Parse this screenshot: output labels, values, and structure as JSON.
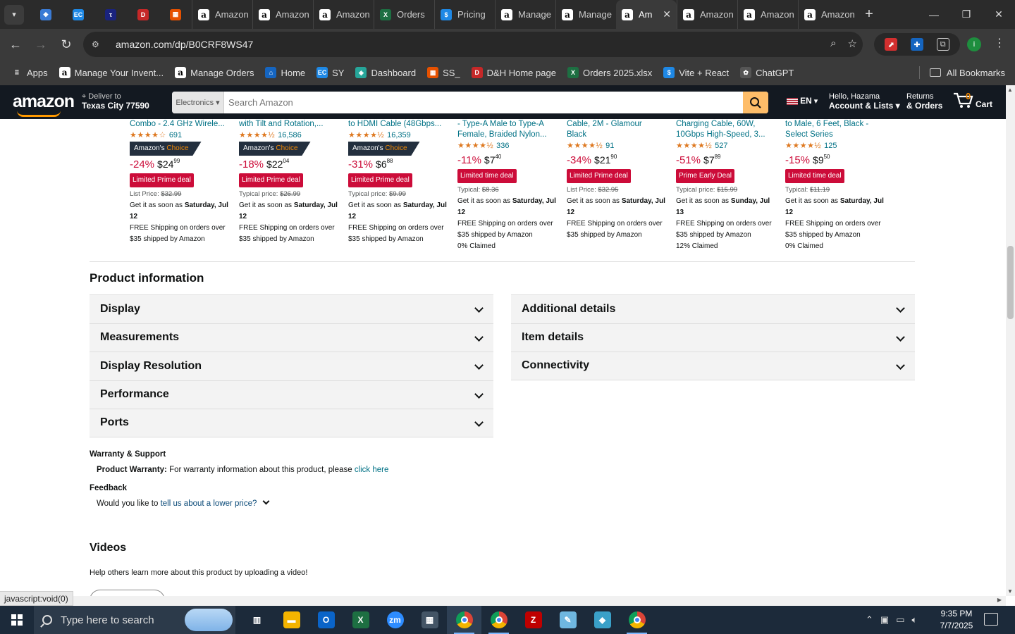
{
  "browser": {
    "pinned_tabs": [
      {
        "icon": "dell-icon",
        "color": "#3a7bd5"
      },
      {
        "icon": "ec-icon",
        "color": "#1e88e5",
        "text": "EC"
      },
      {
        "icon": "tau-icon",
        "color": "#1a237e",
        "text": "tau"
      },
      {
        "icon": "dh-icon",
        "color": "#c62828",
        "text": "D&H"
      },
      {
        "icon": "package-icon",
        "color": "#e65100"
      }
    ],
    "tabs": [
      {
        "label": "Amazon",
        "icon": "amazon-icon"
      },
      {
        "label": "Amazon",
        "icon": "amazon-icon"
      },
      {
        "label": "Amazon",
        "icon": "amazon-icon"
      },
      {
        "label": "Orders",
        "icon": "excel-icon"
      },
      {
        "label": "Pricing",
        "icon": "dollar-icon"
      },
      {
        "label": "Manage",
        "icon": "amazon-icon"
      },
      {
        "label": "Manage",
        "icon": "amazon-icon"
      },
      {
        "label": "Am",
        "icon": "amazon-icon",
        "active": true
      },
      {
        "label": "Amazon",
        "icon": "amazon-icon"
      },
      {
        "label": "Amazon",
        "icon": "amazon-icon"
      },
      {
        "label": "Amazon",
        "icon": "amazon-icon"
      }
    ],
    "url": "amazon.com/dp/B0CRF8WS47",
    "bookmarks": [
      {
        "label": "Apps",
        "icon": "apps-grid-icon"
      },
      {
        "label": "Manage Your Invent...",
        "icon": "amazon-icon"
      },
      {
        "label": "Manage Orders",
        "icon": "amazon-icon"
      },
      {
        "label": "Home",
        "icon": "home-icon"
      },
      {
        "label": "SY",
        "icon": "ec-icon"
      },
      {
        "label": "Dashboard",
        "icon": "dashboard-icon"
      },
      {
        "label": "SS_",
        "icon": "package-icon"
      },
      {
        "label": "D&H Home page",
        "icon": "dh-icon"
      },
      {
        "label": "Orders 2025.xlsx",
        "icon": "excel-icon"
      },
      {
        "label": "Vite + React",
        "icon": "dollar-icon"
      },
      {
        "label": "ChatGPT",
        "icon": "chatgpt-icon"
      }
    ],
    "all_bookmarks": "All Bookmarks",
    "status_text": "javascript:void(0)"
  },
  "amazon_header": {
    "logo": "amazon",
    "deliver_line1": "Deliver to",
    "deliver_line2": "Texas City 77590",
    "search_dept": "Electronics ▾",
    "search_placeholder": "Search Amazon",
    "lang": "EN",
    "account_line1": "Hello, Hazama",
    "account_line2": "Account & Lists ▾",
    "returns_line1": "Returns",
    "returns_line2": "& Orders",
    "cart_count": "0",
    "cart_label": "Cart"
  },
  "products": [
    {
      "title": "Combo - 2.4 GHz Wirele...",
      "stars": "★★★★☆",
      "rating_count": "691",
      "choice": true,
      "discount": "-24%",
      "dollars": "$24",
      "cents": "99",
      "deal": "Limited Prime deal",
      "list_label": "List Price:",
      "list_price": "$32.99",
      "delivery_pre": "Get it as soon as ",
      "delivery_day": "Saturday, Jul 12",
      "shipping": "FREE Shipping on orders over $35 shipped by Amazon",
      "claimed": ""
    },
    {
      "title": "with Tilt and Rotation,...",
      "stars": "★★★★½",
      "rating_count": "16,586",
      "choice": true,
      "discount": "-18%",
      "dollars": "$22",
      "cents": "04",
      "deal": "Limited Prime deal",
      "list_label": "Typical price:",
      "list_price": "$26.99",
      "delivery_pre": "Get it as soon as ",
      "delivery_day": "Saturday, Jul 12",
      "shipping": "FREE Shipping on orders over $35 shipped by Amazon",
      "claimed": ""
    },
    {
      "title": "to HDMI Cable (48Gbps...",
      "stars": "★★★★½",
      "rating_count": "16,359",
      "choice": true,
      "discount": "-31%",
      "dollars": "$6",
      "cents": "88",
      "deal": "Limited Prime deal",
      "list_label": "Typical price:",
      "list_price": "$9.99",
      "delivery_pre": "Get it as soon as ",
      "delivery_day": "Saturday, Jul 12",
      "shipping": "FREE Shipping on orders over $35 shipped by Amazon",
      "claimed": ""
    },
    {
      "title": "- Type-A Male to Type-A",
      "title2": "Female, Braided Nylon...",
      "stars": "★★★★½",
      "rating_count": "336",
      "choice": false,
      "discount": "-11%",
      "dollars": "$7",
      "cents": "40",
      "deal": "Limited time deal",
      "list_label": "Typical:",
      "list_price": "$8.36",
      "delivery_pre": "Get it as soon as ",
      "delivery_day": "Saturday, Jul 12",
      "shipping": "FREE Shipping on orders over $35 shipped by Amazon",
      "claimed": "0% Claimed"
    },
    {
      "title": "Cable, 2M - Glamour",
      "title2": "Black",
      "stars": "★★★★½",
      "rating_count": "91",
      "choice": false,
      "discount": "-34%",
      "dollars": "$21",
      "cents": "90",
      "deal": "Limited Prime deal",
      "list_label": "List Price:",
      "list_price": "$32.95",
      "delivery_pre": "Get it as soon as ",
      "delivery_day": "Saturday, Jul 12",
      "shipping": "FREE Shipping on orders over $35 shipped by Amazon",
      "claimed": ""
    },
    {
      "title": "Charging Cable, 60W,",
      "title2": "10Gbps High-Speed, 3...",
      "stars": "★★★★½",
      "rating_count": "527",
      "choice": false,
      "discount": "-51%",
      "dollars": "$7",
      "cents": "89",
      "deal": "Prime Early Deal",
      "list_label": "Typical price:",
      "list_price": "$15.99",
      "delivery_pre": "Get it as soon as ",
      "delivery_day": "Sunday, Jul 13",
      "shipping": "FREE Shipping on orders over $35 shipped by Amazon",
      "claimed": "12% Claimed"
    },
    {
      "title": "to Male, 6 Feet, Black -",
      "title2": "Select Series",
      "stars": "★★★★½",
      "rating_count": "125",
      "choice": false,
      "discount": "-15%",
      "dollars": "$9",
      "cents": "50",
      "deal": "Limited time deal",
      "list_label": "Typical:",
      "list_price": "$11.19",
      "delivery_pre": "Get it as soon as ",
      "delivery_day": "Saturday, Jul 12",
      "shipping": "FREE Shipping on orders over $35 shipped by Amazon",
      "claimed": "0% Claimed"
    }
  ],
  "choice_badge": {
    "prefix": "Amazon's",
    "suffix": "Choice"
  },
  "product_info": {
    "heading": "Product information",
    "left_sections": [
      "Display",
      "Measurements",
      "Display Resolution",
      "Performance",
      "Ports"
    ],
    "right_sections": [
      "Additional details",
      "Item details",
      "Connectivity"
    ]
  },
  "warranty": {
    "heading": "Warranty & Support",
    "label": "Product Warranty:",
    "text": " For warranty information about this product, please ",
    "link": "click here"
  },
  "feedback": {
    "heading": "Feedback",
    "text": "Would you like to ",
    "link": "tell us about a lower price?"
  },
  "videos": {
    "heading": "Videos",
    "text": "Help others learn more about this product by uploading a video!"
  },
  "taskbar": {
    "search_placeholder": "Type here to search",
    "apps": [
      {
        "icon": "task-view-icon"
      },
      {
        "icon": "file-explorer-icon"
      },
      {
        "icon": "outlook-icon"
      },
      {
        "icon": "excel-icon"
      },
      {
        "icon": "zoom-icon"
      },
      {
        "icon": "calculator-icon"
      },
      {
        "icon": "chrome-icon",
        "active": true
      },
      {
        "icon": "chrome-icon"
      },
      {
        "icon": "filezilla-icon"
      },
      {
        "icon": "notepad-icon"
      },
      {
        "icon": "app-icon"
      },
      {
        "icon": "chrome-profile-icon"
      }
    ],
    "time": "9:35 PM",
    "date": "7/7/2025"
  }
}
